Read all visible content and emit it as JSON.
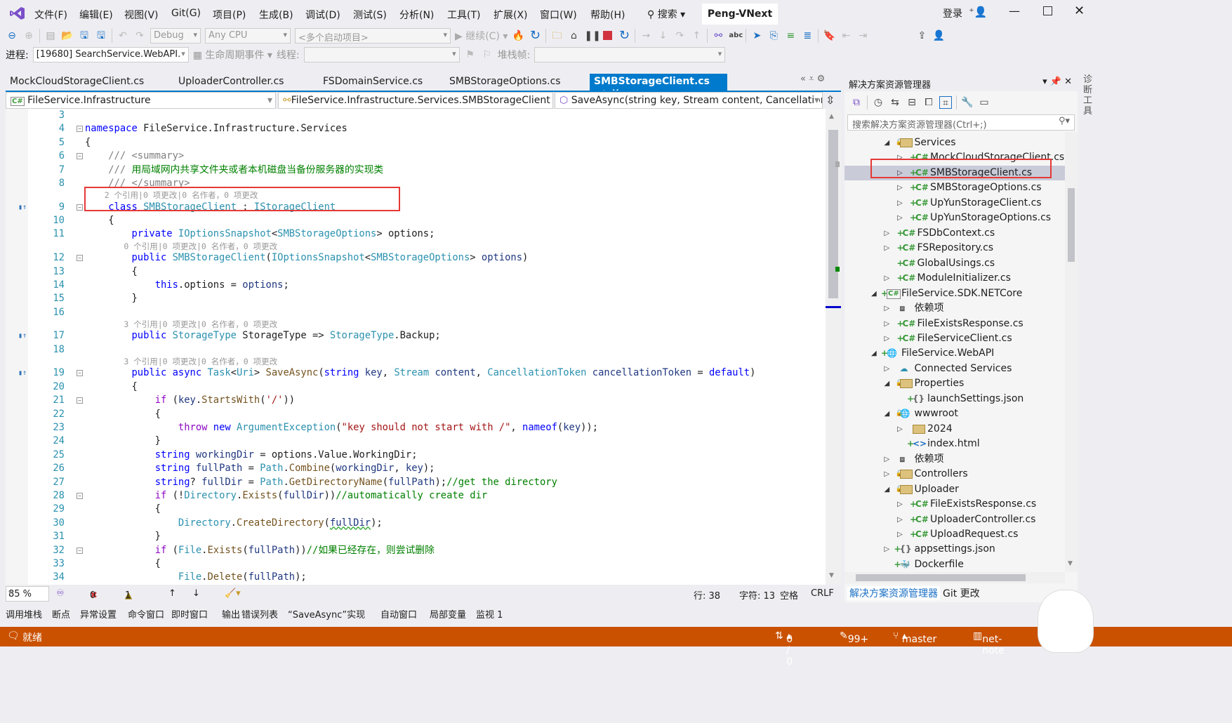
{
  "menu": {
    "items": [
      "文件(F)",
      "编辑(E)",
      "视图(V)",
      "Git(G)",
      "项目(P)",
      "生成(B)",
      "调试(D)",
      "测试(S)",
      "分析(N)",
      "工具(T)",
      "扩展(X)",
      "窗口(W)",
      "帮助(H)"
    ],
    "search": "搜索",
    "title": "Peng-VNext",
    "login": "登录"
  },
  "toolbar": {
    "config": "Debug",
    "platform": "Any CPU",
    "startup": "<多个启动项目>",
    "continue": "继续(C)"
  },
  "debugbar": {
    "process_label": "进程:",
    "process": "[19680] SearchService.WebAPI.",
    "lifecycle": "生命周期事件",
    "thread_label": "线程:",
    "stack_label": "堆栈帧:"
  },
  "tabs": [
    {
      "label": "MockCloudStorageClient.cs"
    },
    {
      "label": "UploaderController.cs"
    },
    {
      "label": "FSDomainService.cs"
    },
    {
      "label": "SMBStorageOptions.cs"
    },
    {
      "label": "SMBStorageClient.cs",
      "active": true
    }
  ],
  "navbar": {
    "project": "FileService.Infrastructure",
    "type": "FileService.Infrastructure.Services.SMBStorageClient",
    "member": "SaveAsync(string key, Stream content, CancellationTo"
  },
  "code": [
    {
      "n": "3",
      "t": []
    },
    {
      "n": "4",
      "f": 1,
      "t": [
        [
          "kw",
          "namespace"
        ],
        [
          "",
          " FileService.Infrastructure.Services"
        ]
      ]
    },
    {
      "n": "5",
      "t": [
        [
          "",
          "{"
        ]
      ]
    },
    {
      "n": "6",
      "f": 1,
      "t": [
        [
          "doc",
          "    /// <summary>"
        ]
      ]
    },
    {
      "n": "7",
      "t": [
        [
          "doc",
          "    /// "
        ],
        [
          "cm",
          "用局域网内共享文件夹或者本机磁盘当备份服务器的实现类"
        ]
      ]
    },
    {
      "n": "8",
      "t": [
        [
          "doc",
          "    /// </summary>"
        ]
      ]
    },
    {
      "lens": "    2 个引用|0 项更改|0 名作者，0 项更改"
    },
    {
      "n": "9",
      "f": 1,
      "r": 1,
      "t": [
        [
          "",
          "    "
        ],
        [
          "kw",
          "class"
        ],
        [
          "",
          " "
        ],
        [
          "ty",
          "SMBStorageClient"
        ],
        [
          "",
          " : "
        ],
        [
          "ty",
          "IStorageClient"
        ]
      ]
    },
    {
      "n": "10",
      "t": [
        [
          "",
          "    {"
        ]
      ]
    },
    {
      "n": "11",
      "t": [
        [
          "",
          "        "
        ],
        [
          "kw",
          "private"
        ],
        [
          "",
          " "
        ],
        [
          "ty",
          "IOptionsSnapshot"
        ],
        [
          "",
          "<"
        ],
        [
          "ty",
          "SMBStorageOptions"
        ],
        [
          "",
          "> options;"
        ]
      ]
    },
    {
      "lens": "        0 个引用|0 项更改|0 名作者，0 项更改"
    },
    {
      "n": "12",
      "f": 1,
      "t": [
        [
          "",
          "        "
        ],
        [
          "kw",
          "public"
        ],
        [
          "",
          " "
        ],
        [
          "ty",
          "SMBStorageClient"
        ],
        [
          "",
          "("
        ],
        [
          "ty",
          "IOptionsSnapshot"
        ],
        [
          "",
          "<"
        ],
        [
          "ty",
          "SMBStorageOptions"
        ],
        [
          "",
          "> "
        ],
        [
          "var",
          "options"
        ],
        [
          "",
          ")"
        ]
      ]
    },
    {
      "n": "13",
      "t": [
        [
          "",
          "        {"
        ]
      ]
    },
    {
      "n": "14",
      "t": [
        [
          "",
          "            "
        ],
        [
          "kw",
          "this"
        ],
        [
          "",
          ".options = "
        ],
        [
          "var",
          "options"
        ],
        [
          "",
          ";"
        ]
      ]
    },
    {
      "n": "15",
      "t": [
        [
          "",
          "        }"
        ]
      ]
    },
    {
      "n": "16",
      "t": []
    },
    {
      "lens": "        3 个引用|0 项更改|0 名作者，0 项更改"
    },
    {
      "n": "17",
      "r": 1,
      "t": [
        [
          "",
          "        "
        ],
        [
          "kw",
          "public"
        ],
        [
          "",
          " "
        ],
        [
          "ty",
          "StorageType"
        ],
        [
          "",
          " StorageType => "
        ],
        [
          "ty",
          "StorageType"
        ],
        [
          "",
          ".Backup;"
        ]
      ]
    },
    {
      "n": "18",
      "t": []
    },
    {
      "lens": "        3 个引用|0 项更改|0 名作者，0 项更改"
    },
    {
      "n": "19",
      "f": 1,
      "r": 1,
      "t": [
        [
          "",
          "        "
        ],
        [
          "kw",
          "public async"
        ],
        [
          "",
          " "
        ],
        [
          "ty",
          "Task"
        ],
        [
          "",
          "<"
        ],
        [
          "ty",
          "Uri"
        ],
        [
          "",
          "> "
        ],
        [
          "mt",
          "SaveAsync"
        ],
        [
          "",
          "("
        ],
        [
          "kw",
          "string"
        ],
        [
          "",
          " "
        ],
        [
          "var",
          "key"
        ],
        [
          "",
          ", "
        ],
        [
          "ty",
          "Stream"
        ],
        [
          "",
          " "
        ],
        [
          "var",
          "content"
        ],
        [
          "",
          ", "
        ],
        [
          "ty",
          "CancellationToken"
        ],
        [
          "",
          " "
        ],
        [
          "var",
          "cancellationToken"
        ],
        [
          "",
          " = "
        ],
        [
          "kw",
          "default"
        ],
        [
          "",
          ")"
        ]
      ]
    },
    {
      "n": "20",
      "t": [
        [
          "",
          "        {"
        ]
      ]
    },
    {
      "n": "21",
      "f": 1,
      "t": [
        [
          "",
          "            "
        ],
        [
          "ctl",
          "if"
        ],
        [
          "",
          " ("
        ],
        [
          "var",
          "key"
        ],
        [
          "",
          "."
        ],
        [
          "mt",
          "StartsWith"
        ],
        [
          "",
          "("
        ],
        [
          "str",
          "'/'"
        ],
        [
          "",
          "))"
        ]
      ]
    },
    {
      "n": "22",
      "t": [
        [
          "",
          "            {"
        ]
      ]
    },
    {
      "n": "23",
      "t": [
        [
          "",
          "                "
        ],
        [
          "ctl",
          "throw"
        ],
        [
          "",
          " "
        ],
        [
          "kw",
          "new"
        ],
        [
          "",
          " "
        ],
        [
          "ty",
          "ArgumentException"
        ],
        [
          "",
          "("
        ],
        [
          "str",
          "\"key should not start with /\""
        ],
        [
          "",
          ", "
        ],
        [
          "kw",
          "nameof"
        ],
        [
          "",
          "("
        ],
        [
          "var",
          "key"
        ],
        [
          "",
          "));"
        ]
      ]
    },
    {
      "n": "24",
      "t": [
        [
          "",
          "            }"
        ]
      ]
    },
    {
      "n": "25",
      "t": [
        [
          "",
          "            "
        ],
        [
          "kw",
          "string"
        ],
        [
          "",
          " "
        ],
        [
          "var",
          "workingDir"
        ],
        [
          "",
          " = options.Value.WorkingDir;"
        ]
      ]
    },
    {
      "n": "26",
      "t": [
        [
          "",
          "            "
        ],
        [
          "kw",
          "string"
        ],
        [
          "",
          " "
        ],
        [
          "var",
          "fullPath"
        ],
        [
          "",
          " = "
        ],
        [
          "ty",
          "Path"
        ],
        [
          "",
          "."
        ],
        [
          "mt",
          "Combine"
        ],
        [
          "",
          "("
        ],
        [
          "var",
          "workingDir"
        ],
        [
          "",
          ", "
        ],
        [
          "var",
          "key"
        ],
        [
          "",
          ");"
        ]
      ]
    },
    {
      "n": "27",
      "t": [
        [
          "",
          "            "
        ],
        [
          "kw",
          "string"
        ],
        [
          "",
          "? "
        ],
        [
          "var",
          "fullDir"
        ],
        [
          "",
          " = "
        ],
        [
          "ty",
          "Path"
        ],
        [
          "",
          "."
        ],
        [
          "mt",
          "GetDirectoryName"
        ],
        [
          "",
          "("
        ],
        [
          "var",
          "fullPath"
        ],
        [
          "",
          ");"
        ],
        [
          "cm",
          "//get the directory"
        ]
      ]
    },
    {
      "n": "28",
      "f": 1,
      "t": [
        [
          "",
          "            "
        ],
        [
          "ctl",
          "if"
        ],
        [
          "",
          " (!"
        ],
        [
          "ty",
          "Directory"
        ],
        [
          "",
          "."
        ],
        [
          "mt",
          "Exists"
        ],
        [
          "",
          "("
        ],
        [
          "var",
          "fullDir"
        ],
        [
          "",
          "))"
        ],
        [
          "cm",
          "//automatically create dir"
        ]
      ]
    },
    {
      "n": "29",
      "t": [
        [
          "",
          "            {"
        ]
      ]
    },
    {
      "n": "30",
      "t": [
        [
          "",
          "                "
        ],
        [
          "ty",
          "Directory"
        ],
        [
          "",
          "."
        ],
        [
          "mt",
          "CreateDirectory"
        ],
        [
          "",
          "("
        ],
        [
          "var sq",
          "fullDir"
        ],
        [
          "",
          ");"
        ]
      ]
    },
    {
      "n": "31",
      "t": [
        [
          "",
          "            }"
        ]
      ]
    },
    {
      "n": "32",
      "f": 1,
      "t": [
        [
          "",
          "            "
        ],
        [
          "ctl",
          "if"
        ],
        [
          "",
          " ("
        ],
        [
          "ty",
          "File"
        ],
        [
          "",
          "."
        ],
        [
          "mt",
          "Exists"
        ],
        [
          "",
          "("
        ],
        [
          "var",
          "fullPath"
        ],
        [
          "",
          "))"
        ],
        [
          "cm",
          "//如果已经存在，则尝试删除"
        ]
      ]
    },
    {
      "n": "33",
      "t": [
        [
          "",
          "            {"
        ]
      ]
    },
    {
      "n": "34",
      "t": [
        [
          "",
          "                "
        ],
        [
          "ty",
          "File"
        ],
        [
          "",
          "."
        ],
        [
          "mt",
          "Delete"
        ],
        [
          "",
          "("
        ],
        [
          "var",
          "fullPath"
        ],
        [
          "",
          ");"
        ]
      ]
    },
    {
      "n": "35",
      "t": [
        [
          "",
          "            }"
        ]
      ]
    }
  ],
  "editor_status": {
    "zoom": "85 %",
    "errors": "0",
    "warnings": "1",
    "line": "行: 38",
    "char": "字符: 13",
    "whitespace": "空格",
    "eol": "CRLF"
  },
  "bottom_tabs": [
    "调用堆栈",
    "断点",
    "异常设置",
    "命令窗口",
    "即时窗口",
    "输出",
    "错误列表",
    "“SaveAsync”实现",
    "自动窗口",
    "局部变量",
    "监视 1"
  ],
  "statusbar": {
    "ready": "就绪",
    "sync": "0 / 0",
    "changes": "99+",
    "branch": "master",
    "repo": "net-note"
  },
  "solution_explorer": {
    "title": "解决方案资源管理器",
    "search_placeholder": "搜索解决方案资源管理器(Ctrl+;)",
    "items": [
      {
        "label": "Services",
        "lvl": 1,
        "exp": "open",
        "icon": "folder",
        "lock": 1
      },
      {
        "label": "MockCloudStorageClient.cs",
        "lvl": 2,
        "exp": "closed",
        "icon": "cs",
        "plus": 1
      },
      {
        "label": "SMBStorageClient.cs",
        "lvl": 2,
        "exp": "closed",
        "icon": "cs",
        "plus": 1,
        "selected": true
      },
      {
        "label": "SMBStorageOptions.cs",
        "lvl": 2,
        "exp": "closed",
        "icon": "cs",
        "plus": 1
      },
      {
        "label": "UpYunStorageClient.cs",
        "lvl": 2,
        "exp": "closed",
        "icon": "cs",
        "plus": 1
      },
      {
        "label": "UpYunStorageOptions.cs",
        "lvl": 2,
        "exp": "closed",
        "icon": "cs",
        "plus": 1
      },
      {
        "label": "FSDbContext.cs",
        "lvl": 1,
        "exp": "closed",
        "icon": "cs",
        "plus": 1
      },
      {
        "label": "FSRepository.cs",
        "lvl": 1,
        "exp": "closed",
        "icon": "cs",
        "plus": 1
      },
      {
        "label": "GlobalUsings.cs",
        "lvl": 1,
        "icon": "cs",
        "plus": 1
      },
      {
        "label": "ModuleInitializer.cs",
        "lvl": 1,
        "exp": "closed",
        "icon": "cs",
        "plus": 1
      },
      {
        "label": "FileService.SDK.NETCore",
        "lvl": 0,
        "exp": "open",
        "icon": "project",
        "plus": 1
      },
      {
        "label": "依赖项",
        "lvl": 1,
        "exp": "closed",
        "icon": "deps"
      },
      {
        "label": "FileExistsResponse.cs",
        "lvl": 1,
        "exp": "closed",
        "icon": "cs",
        "plus": 1
      },
      {
        "label": "FileServiceClient.cs",
        "lvl": 1,
        "exp": "closed",
        "icon": "cs",
        "plus": 1
      },
      {
        "label": "FileService.WebAPI",
        "lvl": 0,
        "exp": "open",
        "icon": "web",
        "plus": 1
      },
      {
        "label": "Connected Services",
        "lvl": 1,
        "exp": "closed",
        "icon": "cloud"
      },
      {
        "label": "Properties",
        "lvl": 1,
        "exp": "open",
        "icon": "folder",
        "lock": 1
      },
      {
        "label": "launchSettings.json",
        "lvl": 2,
        "icon": "json",
        "plus": 1
      },
      {
        "label": "wwwroot",
        "lvl": 1,
        "exp": "open",
        "icon": "globe",
        "lock": 1
      },
      {
        "label": "2024",
        "lvl": 2,
        "exp": "closed",
        "icon": "folder"
      },
      {
        "label": "index.html",
        "lvl": 2,
        "icon": "html",
        "plus": 1
      },
      {
        "label": "依赖项",
        "lvl": 1,
        "exp": "closed",
        "icon": "deps"
      },
      {
        "label": "Controllers",
        "lvl": 1,
        "exp": "closed",
        "icon": "folder",
        "lock": 1
      },
      {
        "label": "Uploader",
        "lvl": 1,
        "exp": "open",
        "icon": "folder",
        "lock": 1
      },
      {
        "label": "FileExistsResponse.cs",
        "lvl": 2,
        "exp": "closed",
        "icon": "cs",
        "plus": 1
      },
      {
        "label": "UploaderController.cs",
        "lvl": 2,
        "exp": "closed",
        "icon": "cs",
        "plus": 1
      },
      {
        "label": "UploadRequest.cs",
        "lvl": 2,
        "exp": "closed",
        "icon": "cs",
        "plus": 1
      },
      {
        "label": "appsettings.json",
        "lvl": 1,
        "exp": "closed",
        "icon": "json",
        "plus": 1
      },
      {
        "label": "Dockerfile",
        "lvl": 1,
        "icon": "docker",
        "plus": 1
      }
    ],
    "tab_solution": "解决方案资源管理器",
    "tab_git": "Git 更改"
  },
  "side_panel": "诊断工具",
  "colors": {
    "accent": "#007acc",
    "status_bar": "#ca5100",
    "highlight_box": "#e53935"
  }
}
